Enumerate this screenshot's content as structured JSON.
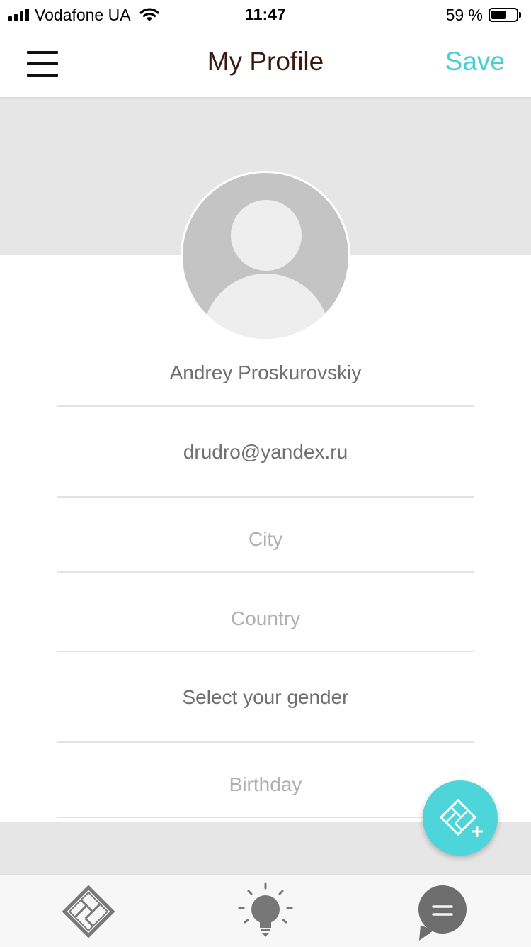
{
  "status_bar": {
    "carrier": "Vodafone UA",
    "time": "11:47",
    "battery_percent": "59 %",
    "battery_level": 0.59
  },
  "navbar": {
    "title": "My Profile",
    "save_label": "Save",
    "menu_icon": "hamburger-menu-icon"
  },
  "profile": {
    "avatar_icon": "default-avatar-icon",
    "name": "Andrey Proskurovskiy",
    "email": "drudro@yandex.ru",
    "city_placeholder": "City",
    "country_placeholder": "Country",
    "gender_value": "Select your gender",
    "birthday_placeholder": "Birthday"
  },
  "fab": {
    "icon": "add-floor-plan-icon"
  },
  "tabbar": {
    "tabs": [
      {
        "icon": "floor-plan-icon"
      },
      {
        "icon": "lightbulb-icon"
      },
      {
        "icon": "chat-bubble-icon"
      }
    ]
  },
  "colors": {
    "accent": "#45d0d6",
    "title": "#3a1a10",
    "band": "#e6e6e6"
  }
}
